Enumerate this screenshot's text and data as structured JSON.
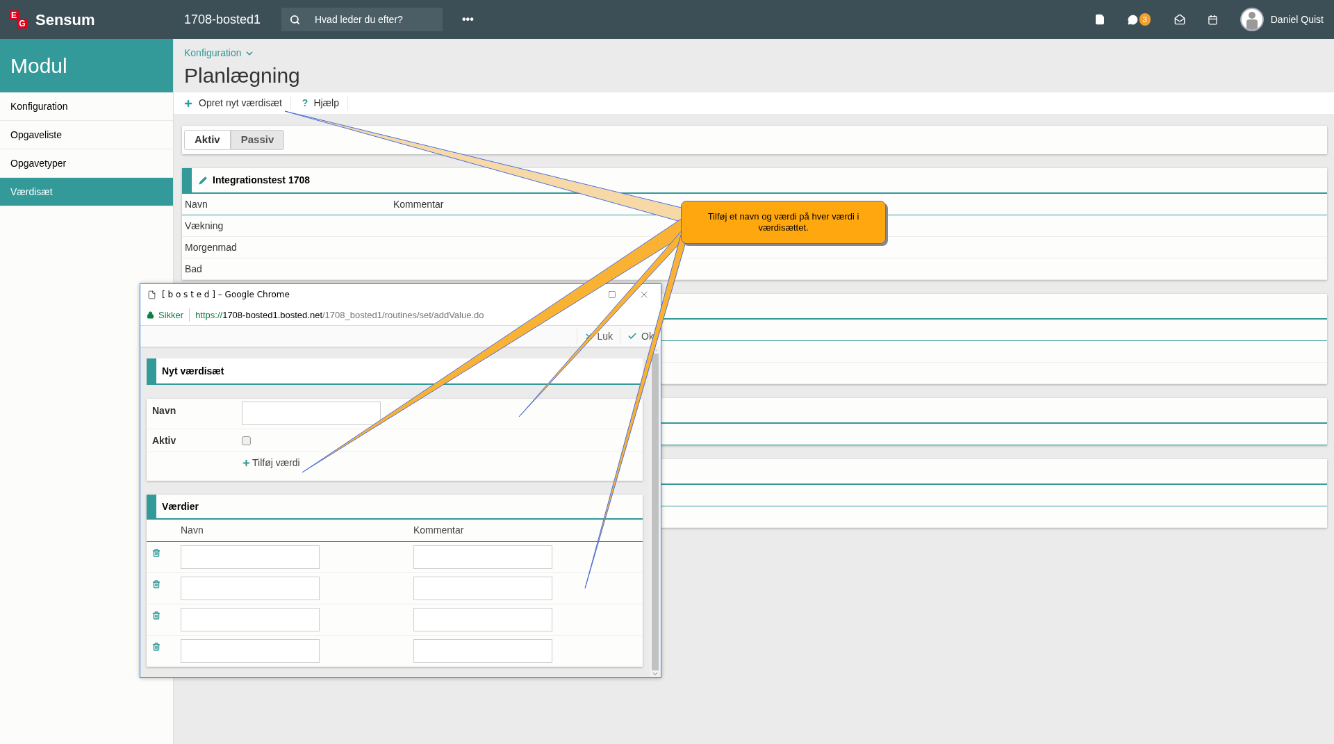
{
  "topbar": {
    "logo_letters": [
      "E",
      "G"
    ],
    "brand": "Sensum",
    "site": "1708-bosted1",
    "search": {
      "placeholder": "Hvad leder du efter?"
    },
    "more": "•••",
    "chat_badge": "3",
    "user": "Daniel Quist"
  },
  "sidebar": {
    "title": "Modul",
    "items": [
      {
        "label": "Konfiguration",
        "selected": false
      },
      {
        "label": "Opgaveliste",
        "selected": false
      },
      {
        "label": "Opgavetyper",
        "selected": false
      },
      {
        "label": "Værdisæt",
        "selected": true
      }
    ]
  },
  "breadcrumb": "Konfiguration",
  "page_title": "Planlægning",
  "toolbar": [
    {
      "kind": "add",
      "label": "Opret nyt værdisæt"
    },
    {
      "kind": "help",
      "glyph": "?",
      "label": "Hjælp"
    }
  ],
  "tabs": [
    {
      "label": "Aktiv",
      "selected": true
    },
    {
      "label": "Passiv",
      "selected": false
    }
  ],
  "panel": {
    "title": "Integrationstest 1708",
    "columns": [
      "Navn",
      "Kommentar"
    ],
    "rows": [
      "Vækning",
      "Morgenmad",
      "Bad"
    ]
  },
  "popup": {
    "title": "[ b o s t e d ] – Google Chrome",
    "security": "Sikker",
    "url_scheme": "https://",
    "url_host": "1708-bosted1.bosted.net",
    "url_path": "/1708_bosted1/routines/set/addValue.do",
    "actions": [
      {
        "kind": "close",
        "label": "Luk"
      },
      {
        "kind": "ok",
        "label": "Ok"
      }
    ],
    "form_title": "Nyt værdisæt",
    "fields": [
      {
        "kind": "text",
        "label": "Navn"
      },
      {
        "kind": "checkbox",
        "label": "Aktiv",
        "checked": false
      }
    ],
    "add_value": "Tilføj værdi",
    "values": {
      "title": "Værdier",
      "columns": [
        "Navn",
        "Kommentar"
      ],
      "rows": [
        {
          "kind": "input_row"
        },
        {
          "kind": "input_row"
        },
        {
          "kind": "input_row"
        },
        {
          "kind": "input_row"
        }
      ]
    }
  },
  "callout": {
    "text": "Tilføj et navn og værdi på hver værdi i værdisættet."
  }
}
